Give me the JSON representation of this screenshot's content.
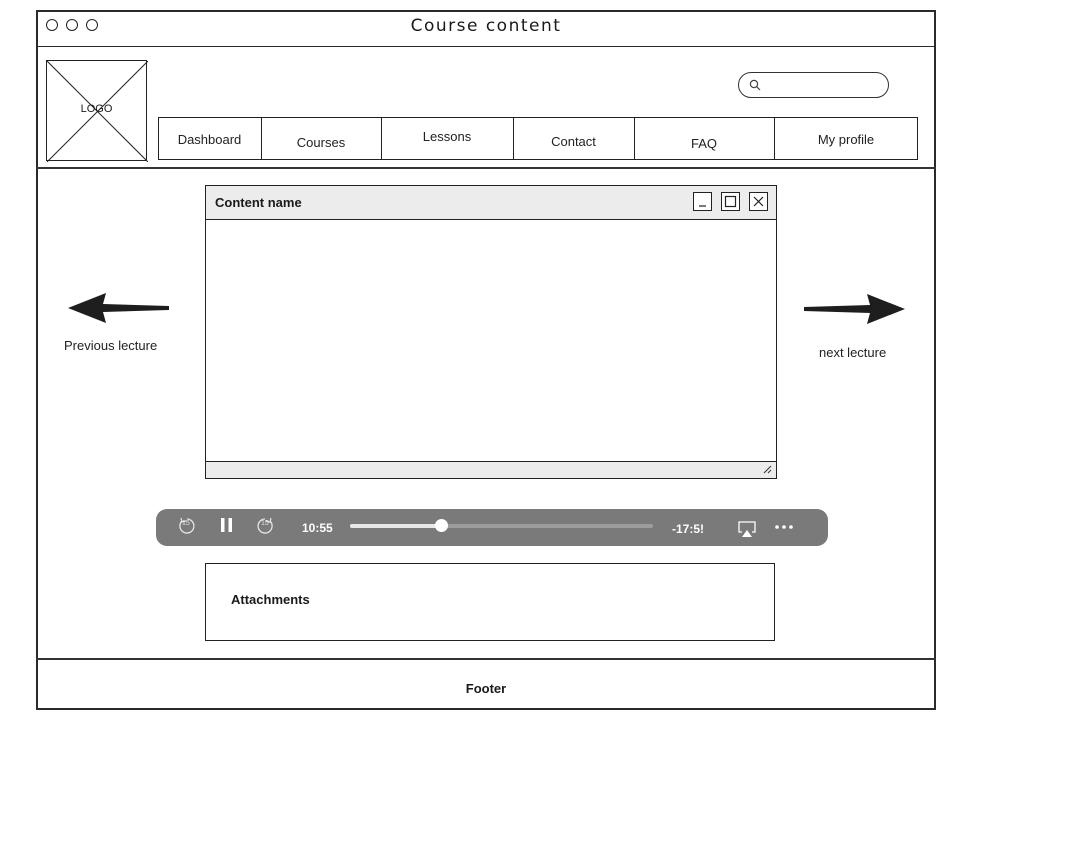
{
  "window": {
    "title": "Course content"
  },
  "header": {
    "logo_text": "LOGO",
    "search": {
      "value": "",
      "placeholder": ""
    },
    "nav": [
      "Dashboard",
      "Courses",
      "Lessons",
      "Contact",
      "FAQ",
      "My profile"
    ]
  },
  "navigation": {
    "previous_label": "Previous lecture",
    "next_label": "next lecture"
  },
  "content_window": {
    "title": "Content name"
  },
  "player": {
    "elapsed": "10:55",
    "remaining": "-17:5!",
    "progress": 0.3,
    "skip_seconds": "15"
  },
  "attachments": {
    "title": "Attachments"
  },
  "footer": {
    "text": "Footer"
  }
}
